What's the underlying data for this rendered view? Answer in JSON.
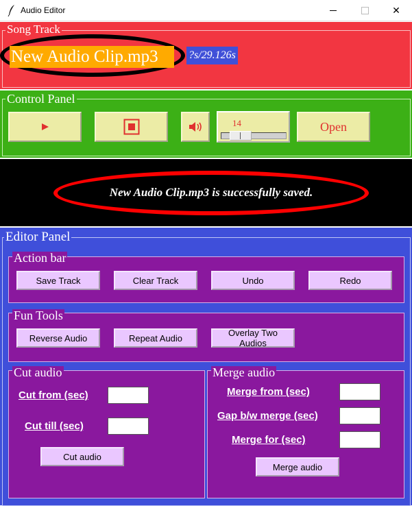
{
  "window": {
    "title": "Audio Editor",
    "minimize": "—",
    "maximize": "☐",
    "close": "✕"
  },
  "song_track": {
    "legend": "Song Track",
    "file_name": "New Audio Clip.mp3",
    "time": "?s/29.126s"
  },
  "control_panel": {
    "legend": "Control Panel",
    "play_icon": "play-icon",
    "stop_icon": "stop-icon",
    "speaker_icon": "speaker-icon",
    "volume": "14",
    "volume_level": 0.14,
    "open_label": "Open"
  },
  "message": {
    "text": "New Audio Clip.mp3 is successfully saved."
  },
  "editor_panel": {
    "legend": "Editor Panel",
    "action_bar": {
      "legend": "Action bar",
      "buttons": [
        "Save Track",
        "Clear Track",
        "Undo",
        "Redo"
      ]
    },
    "fun_tools": {
      "legend": "Fun Tools",
      "buttons": [
        "Reverse Audio",
        "Repeat Audio",
        "Overlay Two Audios"
      ]
    },
    "cut_audio": {
      "legend": "Cut audio",
      "from_label": "Cut from (sec)",
      "till_label": "Cut till (sec)",
      "button": "Cut audio"
    },
    "merge_audio": {
      "legend": "Merge audio",
      "from_label": "Merge from (sec)",
      "gap_label": "Gap b/w merge (sec)",
      "for_label": "Merge for (sec)",
      "button": "Merge audio"
    }
  },
  "colors": {
    "song": "#f23641",
    "control": "#3cb016",
    "message": "#000000",
    "editor": "#3f4fda",
    "subpanel": "#8a189e",
    "button": "#ececa6",
    "pbutton": "#eac7ff"
  }
}
